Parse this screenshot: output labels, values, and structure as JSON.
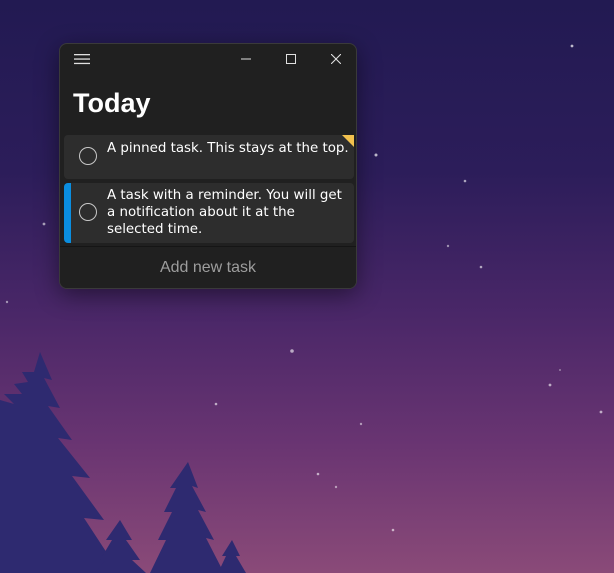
{
  "window": {
    "heading": "Today",
    "titlebar": {
      "menu_icon": "hamburger-icon",
      "minimize_icon": "minimize-icon",
      "maximize_icon": "maximize-icon",
      "close_icon": "close-icon"
    },
    "tasks": [
      {
        "text": "A pinned task. This stays at the top.",
        "pinned": true,
        "reminder": false
      },
      {
        "text": "A task with a reminder. You will get a notification about it at the selected time.",
        "pinned": false,
        "reminder": true
      }
    ],
    "add_task_label": "Add new task"
  },
  "colors": {
    "window_bg": "#202020",
    "task_bg": "#2d2d2d",
    "reminder_accent": "#0a8ee0",
    "pin_accent": "#f2c14e"
  }
}
